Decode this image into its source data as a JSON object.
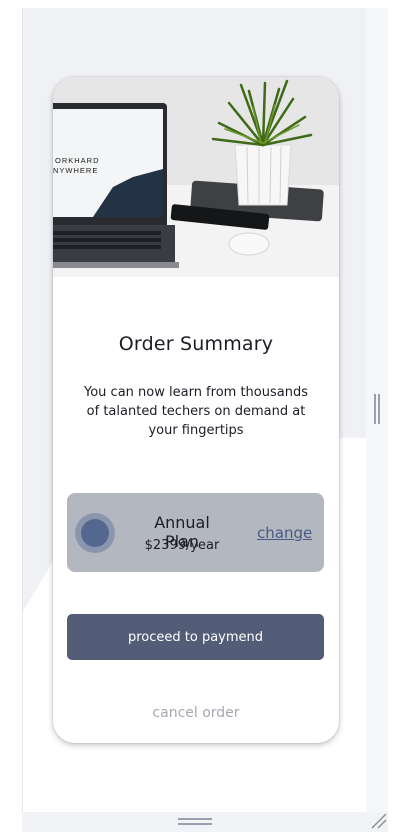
{
  "hero": {
    "laptop_screen_text": [
      "ORKHARD",
      "NYWHERE"
    ]
  },
  "order": {
    "title": "Order Summary",
    "description": "You can now learn from thousands of talanted techers on demand at your fingertips"
  },
  "plan": {
    "name": "Annual Plan",
    "price": "$2399/year",
    "change_label": "change"
  },
  "actions": {
    "proceed_label": "proceed to paymend",
    "cancel_label": "cancel order"
  },
  "colors": {
    "accent": "#545d77",
    "plan_bg": "#b3b7c0",
    "radio": "#54688f",
    "link": "#4a5a85",
    "muted": "#a6a8b3"
  },
  "icons": {
    "plan_selector": "radio-selected-icon",
    "right_handle": "resize-handle-icon",
    "bottom_handle": "resize-handle-icon",
    "corner": "resize-grip-icon"
  }
}
